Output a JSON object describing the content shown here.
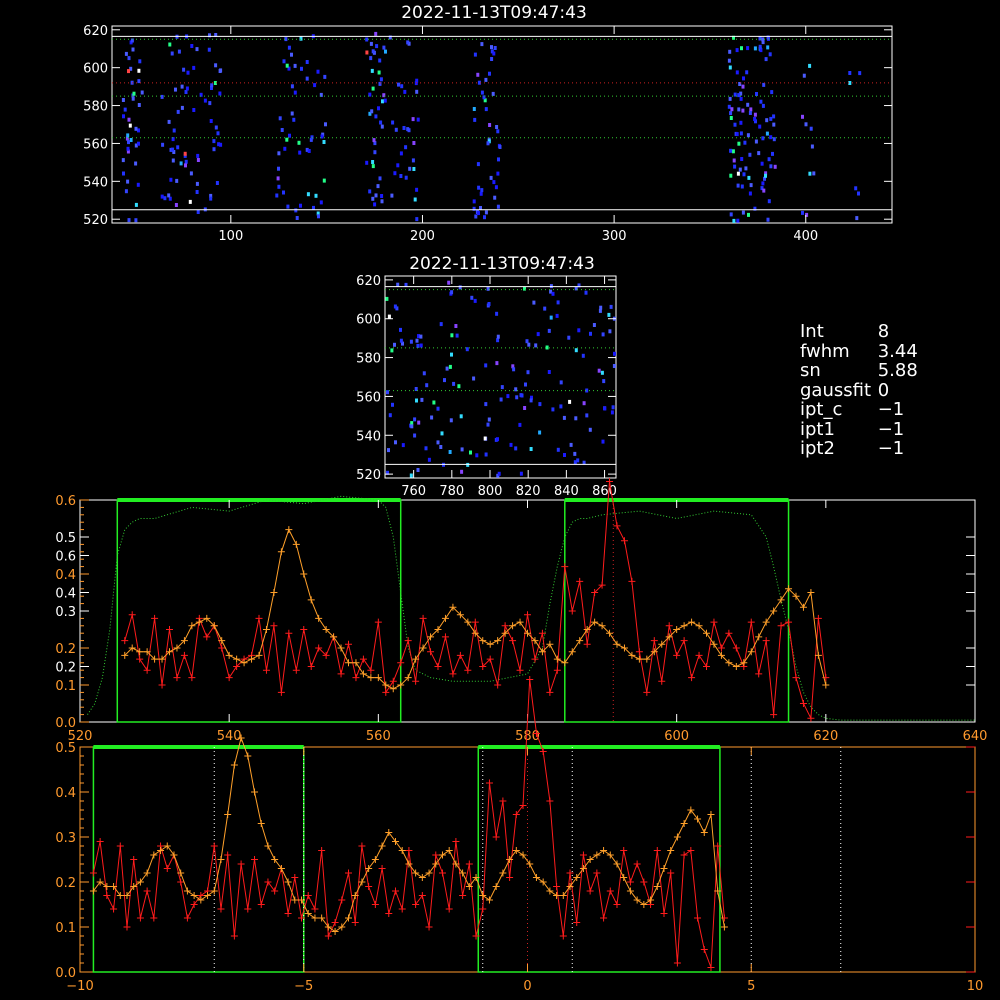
{
  "colors": {
    "background": "#000000",
    "axis": "#ffffff",
    "orange_axis": "#ff9a2e",
    "orange_series": "#ffa02a",
    "red_series": "#ff1c1c",
    "green_window": "#22ee22",
    "green_dotted": "#33cc33",
    "red_dotted": "#cc2222",
    "white_dotted": "#ffffff"
  },
  "top_image": {
    "title": "2022-11-13T09:47:43",
    "xlim": [
      38,
      445
    ],
    "ylim": [
      518,
      622
    ],
    "xticks": [
      100,
      200,
      300,
      400
    ],
    "yticks": [
      520,
      540,
      560,
      580,
      600,
      620
    ],
    "hlines_white": [
      616.5,
      525
    ],
    "hlines_green": [
      615,
      585,
      563
    ],
    "hlines_red": [
      592
    ]
  },
  "mid_image": {
    "title": "2022-11-13T09:47:43",
    "xlim": [
      745,
      866
    ],
    "ylim": [
      518,
      622
    ],
    "xticks": [
      760,
      780,
      800,
      820,
      840,
      860
    ],
    "yticks": [
      520,
      540,
      560,
      580,
      600,
      620
    ],
    "hlines_white": [
      616.5,
      525
    ],
    "hlines_green": [
      615,
      585,
      563
    ]
  },
  "info": [
    {
      "key": "Int",
      "value": "8"
    },
    {
      "key": "fwhm",
      "value": "3.44"
    },
    {
      "key": "sn",
      "value": "5.88"
    },
    {
      "key": "gaussfit",
      "value": "0"
    },
    {
      "key": "ipt_c",
      "value": "−1"
    },
    {
      "key": "ipt1",
      "value": "−1"
    },
    {
      "key": "ipt2",
      "value": "−1"
    }
  ],
  "chart_data": [
    {
      "type": "line",
      "xlim": [
        520,
        640
      ],
      "ylim": [
        0,
        0.6
      ],
      "xticks": [
        520,
        540,
        560,
        580,
        600,
        620,
        640
      ],
      "yticks_orange": [
        0.0,
        0.1,
        0.2,
        0.4,
        0.5,
        0.6
      ],
      "yticks_white": [
        0.2,
        0.3,
        0.4,
        0.6
      ],
      "ytick_labels": [
        "0.0",
        "0.1",
        "0.2",
        "0.2",
        "0.3",
        "0.4",
        "0.6",
        "0.4",
        "0.5",
        "0.6"
      ],
      "green_windows": [
        [
          525,
          563
        ],
        [
          585,
          615
        ]
      ],
      "red_dotted_x": 591.5,
      "series": [
        {
          "color": "orange",
          "x": [
            526,
            527,
            528,
            529,
            530,
            531,
            532,
            533,
            534,
            535,
            536,
            537,
            538,
            539,
            540,
            541,
            542,
            543,
            544,
            545,
            546,
            547,
            548,
            549,
            550,
            551,
            552,
            553,
            554,
            555,
            556,
            557,
            558,
            559,
            560,
            561,
            562,
            563,
            564,
            565,
            566,
            567,
            568,
            569,
            570,
            571,
            572,
            573,
            574,
            575,
            576,
            577,
            578,
            579,
            580,
            581,
            582,
            583,
            584,
            585,
            586,
            587,
            588,
            589,
            590,
            591,
            592,
            593,
            594,
            595,
            596,
            597,
            598,
            599,
            600,
            601,
            602,
            603,
            604,
            605,
            606,
            607,
            608,
            609,
            610,
            611,
            612,
            613,
            614,
            615,
            616,
            617,
            618,
            619,
            620
          ],
          "y": [
            0.18,
            0.2,
            0.19,
            0.19,
            0.17,
            0.17,
            0.19,
            0.2,
            0.22,
            0.26,
            0.27,
            0.28,
            0.26,
            0.22,
            0.18,
            0.17,
            0.16,
            0.17,
            0.18,
            0.25,
            0.35,
            0.46,
            0.52,
            0.48,
            0.4,
            0.33,
            0.28,
            0.25,
            0.23,
            0.2,
            0.16,
            0.16,
            0.13,
            0.12,
            0.12,
            0.1,
            0.09,
            0.1,
            0.12,
            0.17,
            0.2,
            0.23,
            0.25,
            0.28,
            0.31,
            0.29,
            0.27,
            0.24,
            0.22,
            0.21,
            0.22,
            0.24,
            0.26,
            0.27,
            0.24,
            0.22,
            0.19,
            0.21,
            0.17,
            0.16,
            0.19,
            0.22,
            0.25,
            0.27,
            0.26,
            0.24,
            0.21,
            0.2,
            0.18,
            0.17,
            0.17,
            0.19,
            0.21,
            0.23,
            0.25,
            0.26,
            0.27,
            0.26,
            0.24,
            0.21,
            0.18,
            0.16,
            0.15,
            0.16,
            0.19,
            0.23,
            0.27,
            0.3,
            0.33,
            0.36,
            0.34,
            0.31,
            0.35,
            0.18,
            0.1
          ],
          "name": ""
        },
        {
          "color": "red",
          "x": [
            526,
            527,
            528,
            529,
            530,
            531,
            532,
            533,
            534,
            535,
            536,
            537,
            538,
            539,
            540,
            541,
            542,
            543,
            544,
            545,
            546,
            547,
            548,
            549,
            550,
            551,
            552,
            553,
            554,
            555,
            556,
            557,
            558,
            559,
            560,
            561,
            562,
            563,
            564,
            565,
            566,
            567,
            568,
            569,
            570,
            571,
            572,
            573,
            574,
            575,
            576,
            577,
            578,
            579,
            580,
            581,
            582,
            583,
            584,
            585,
            586,
            587,
            588,
            589,
            590,
            591,
            592,
            593,
            594,
            595,
            596,
            597,
            598,
            599,
            600,
            601,
            602,
            603,
            604,
            605,
            606,
            607,
            608,
            609,
            610,
            611,
            612,
            613,
            614,
            615,
            616,
            617,
            618,
            619,
            620
          ],
          "y": [
            0.22,
            0.29,
            0.17,
            0.14,
            0.28,
            0.1,
            0.25,
            0.12,
            0.18,
            0.12,
            0.28,
            0.23,
            0.26,
            0.2,
            0.12,
            0.15,
            0.17,
            0.18,
            0.28,
            0.14,
            0.26,
            0.08,
            0.24,
            0.14,
            0.25,
            0.15,
            0.2,
            0.18,
            0.23,
            0.13,
            0.21,
            0.12,
            0.17,
            0.14,
            0.27,
            0.08,
            0.11,
            0.16,
            0.22,
            0.11,
            0.28,
            0.19,
            0.15,
            0.23,
            0.13,
            0.18,
            0.14,
            0.27,
            0.15,
            0.17,
            0.1,
            0.26,
            0.22,
            0.14,
            0.29,
            0.17,
            0.24,
            0.08,
            0.14,
            0.42,
            0.3,
            0.38,
            0.21,
            0.35,
            0.37,
            0.65,
            0.53,
            0.49,
            0.38,
            0.19,
            0.08,
            0.22,
            0.11,
            0.26,
            0.18,
            0.22,
            0.12,
            0.18,
            0.15,
            0.27,
            0.2,
            0.24,
            0.2,
            0.15,
            0.27,
            0.13,
            0.22,
            0.02,
            0.26,
            0.27,
            0.12,
            0.05,
            0.01,
            0.28,
            0.12
          ],
          "name": ""
        },
        {
          "color": "green-dotted",
          "x": [
            521,
            522,
            523,
            524,
            525,
            526,
            527,
            528,
            530,
            535,
            540,
            545,
            550,
            555,
            560,
            561,
            562,
            563,
            564,
            565,
            567,
            570,
            575,
            580,
            582,
            583,
            584,
            585,
            586,
            587,
            588,
            590,
            595,
            600,
            605,
            610,
            612,
            613,
            614,
            615,
            616,
            617,
            618,
            619,
            620,
            622,
            625,
            630,
            635,
            640
          ],
          "y": [
            0.02,
            0.05,
            0.12,
            0.25,
            0.45,
            0.52,
            0.54,
            0.55,
            0.55,
            0.58,
            0.57,
            0.6,
            0.59,
            0.61,
            0.6,
            0.58,
            0.5,
            0.35,
            0.2,
            0.14,
            0.12,
            0.11,
            0.11,
            0.13,
            0.2,
            0.32,
            0.42,
            0.5,
            0.54,
            0.55,
            0.55,
            0.56,
            0.57,
            0.55,
            0.57,
            0.56,
            0.5,
            0.42,
            0.33,
            0.25,
            0.15,
            0.08,
            0.04,
            0.02,
            0.01,
            0.005,
            0.005,
            0.005,
            0.005,
            0.005
          ],
          "name": ""
        }
      ]
    },
    {
      "type": "line",
      "xlim": [
        -10,
        10
      ],
      "ylim": [
        0,
        0.5
      ],
      "xticks": [
        -10,
        -5,
        0,
        5,
        10
      ],
      "yticks": [
        0.0,
        0.1,
        0.2,
        0.3,
        0.4,
        0.5
      ],
      "green_windows": [
        [
          -9.7,
          -5.0
        ],
        [
          -1.1,
          4.3
        ]
      ],
      "white_dotted_x": [
        -7,
        -5,
        -1,
        1,
        5,
        7
      ],
      "red_dotted_x": 0,
      "series_x_start": -9.7,
      "series_x_step": 0.15
    }
  ]
}
